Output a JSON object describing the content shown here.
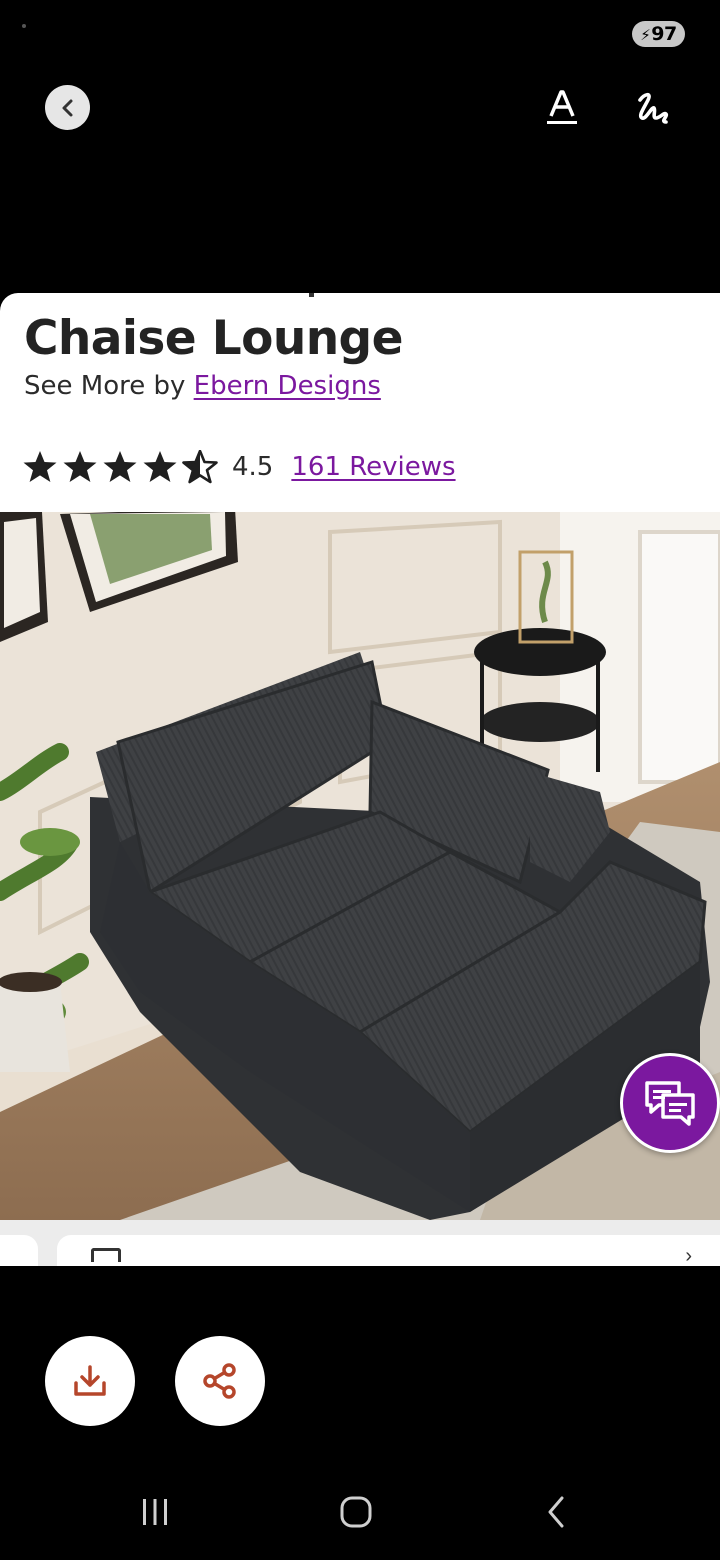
{
  "status_bar": {
    "battery_level": "97"
  },
  "toolbar": {
    "back_icon": "chevron-left-icon",
    "text_tool_icon": "text-a-icon",
    "draw_tool_icon": "scribble-icon"
  },
  "product": {
    "title": "Chaise Lounge",
    "see_more_prefix": "See More by ",
    "brand": "Ebern Designs",
    "rating": "4.5",
    "reviews": "161 Reviews",
    "rating_stars": 4.5
  },
  "colors": {
    "brand_purple": "#7b189f",
    "star": "#1f1f1f",
    "action_icon": "#b5462b"
  },
  "actions": {
    "download_icon": "download-icon",
    "share_icon": "share-icon"
  },
  "nav": {
    "recents_icon": "recents-icon",
    "home_icon": "home-icon",
    "back_icon": "back-icon"
  }
}
